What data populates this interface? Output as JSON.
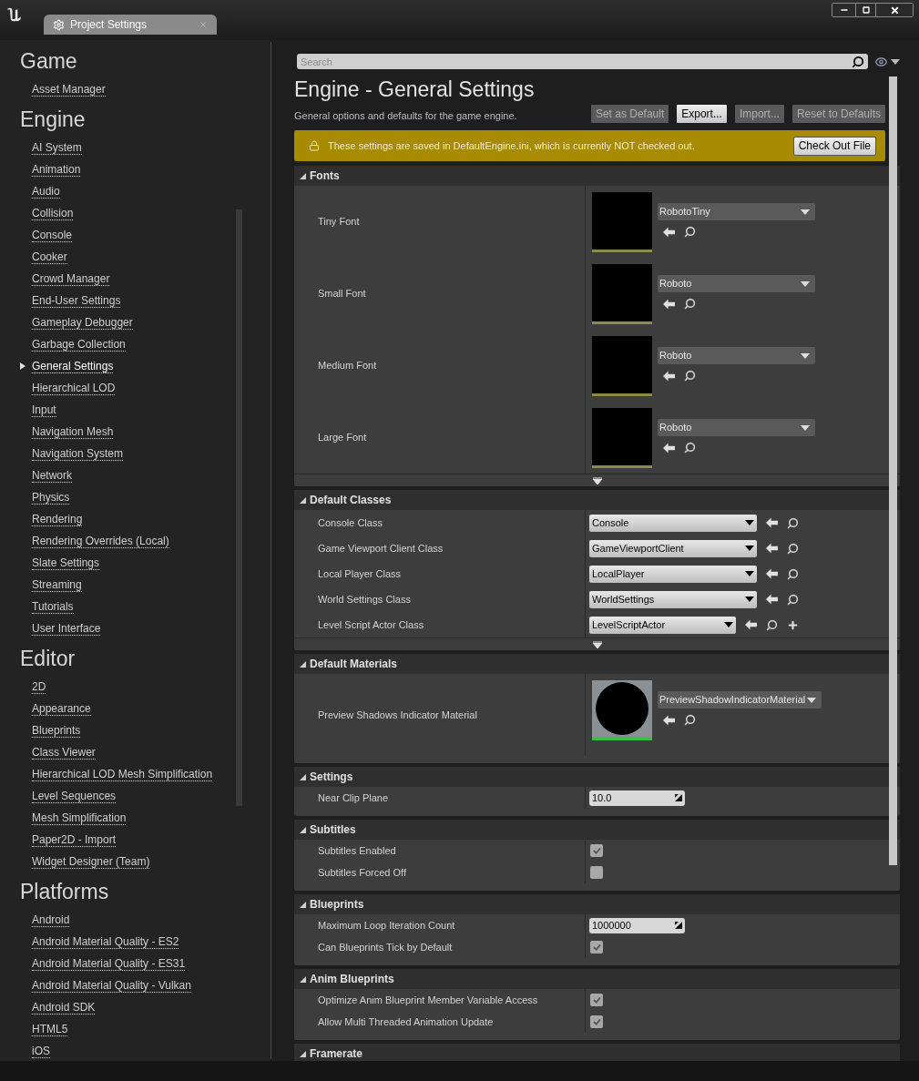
{
  "window": {
    "tab_title": "Project Settings"
  },
  "sidebar": {
    "groups": [
      {
        "title": "Game",
        "items": [
          {
            "label": "Asset Manager",
            "selected": false
          }
        ]
      },
      {
        "title": "Engine",
        "items": [
          {
            "label": "AI System",
            "selected": false
          },
          {
            "label": "Animation",
            "selected": false
          },
          {
            "label": "Audio",
            "selected": false
          },
          {
            "label": "Collision",
            "selected": false
          },
          {
            "label": "Console",
            "selected": false
          },
          {
            "label": "Cooker",
            "selected": false
          },
          {
            "label": "Crowd Manager",
            "selected": false
          },
          {
            "label": "End-User Settings",
            "selected": false
          },
          {
            "label": "Gameplay Debugger",
            "selected": false
          },
          {
            "label": "Garbage Collection",
            "selected": false
          },
          {
            "label": "General Settings",
            "selected": true
          },
          {
            "label": "Hierarchical LOD",
            "selected": false
          },
          {
            "label": "Input",
            "selected": false
          },
          {
            "label": "Navigation Mesh",
            "selected": false
          },
          {
            "label": "Navigation System",
            "selected": false
          },
          {
            "label": "Network",
            "selected": false
          },
          {
            "label": "Physics",
            "selected": false
          },
          {
            "label": "Rendering",
            "selected": false
          },
          {
            "label": "Rendering Overrides (Local)",
            "selected": false
          },
          {
            "label": "Slate Settings",
            "selected": false
          },
          {
            "label": "Streaming",
            "selected": false
          },
          {
            "label": "Tutorials",
            "selected": false
          },
          {
            "label": "User Interface",
            "selected": false
          }
        ]
      },
      {
        "title": "Editor",
        "items": [
          {
            "label": "2D",
            "selected": false
          },
          {
            "label": "Appearance",
            "selected": false
          },
          {
            "label": "Blueprints",
            "selected": false
          },
          {
            "label": "Class Viewer",
            "selected": false
          },
          {
            "label": "Hierarchical LOD Mesh Simplification",
            "selected": false
          },
          {
            "label": "Level Sequences",
            "selected": false
          },
          {
            "label": "Mesh Simplification",
            "selected": false
          },
          {
            "label": "Paper2D - Import",
            "selected": false
          },
          {
            "label": "Widget Designer (Team)",
            "selected": false
          }
        ]
      },
      {
        "title": "Platforms",
        "items": [
          {
            "label": "Android",
            "selected": false
          },
          {
            "label": "Android Material Quality - ES2",
            "selected": false
          },
          {
            "label": "Android Material Quality - ES31",
            "selected": false
          },
          {
            "label": "Android Material Quality - Vulkan",
            "selected": false
          },
          {
            "label": "Android SDK",
            "selected": false
          },
          {
            "label": "HTML5",
            "selected": false
          },
          {
            "label": "iOS",
            "selected": false
          }
        ]
      }
    ]
  },
  "search": {
    "placeholder": "Search"
  },
  "page": {
    "title": "Engine - General Settings",
    "subtitle": "General options and defaults for the game engine.",
    "buttons": [
      {
        "label": "Set as Default",
        "disabled": true
      },
      {
        "label": "Export...",
        "disabled": false
      },
      {
        "label": "Import...",
        "disabled": true
      },
      {
        "label": "Reset to Defaults",
        "disabled": true
      }
    ]
  },
  "banner": {
    "text": "These settings are saved in DefaultEngine.ini, which is currently NOT checked out.",
    "button": "Check Out File"
  },
  "sections": [
    {
      "title": "Fonts",
      "expanded": true,
      "show_advanced": true,
      "rows": [
        {
          "kind": "font",
          "label": "Tiny Font",
          "value": "RobotoTiny"
        },
        {
          "kind": "font",
          "label": "Small Font",
          "value": "Roboto"
        },
        {
          "kind": "font",
          "label": "Medium Font",
          "value": "Roboto"
        },
        {
          "kind": "font",
          "label": "Large Font",
          "value": "Roboto"
        }
      ]
    },
    {
      "title": "Default Classes",
      "expanded": true,
      "show_advanced": true,
      "rows": [
        {
          "kind": "class",
          "label": "Console Class",
          "value": "Console",
          "can_create": false
        },
        {
          "kind": "class",
          "label": "Game Viewport Client Class",
          "value": "GameViewportClient",
          "can_create": false
        },
        {
          "kind": "class",
          "label": "Local Player Class",
          "value": "LocalPlayer",
          "can_create": false
        },
        {
          "kind": "class",
          "label": "World Settings Class",
          "value": "WorldSettings",
          "can_create": false
        },
        {
          "kind": "class",
          "label": "Level Script Actor Class",
          "value": "LevelScriptActor",
          "can_create": true
        }
      ]
    },
    {
      "title": "Default Materials",
      "expanded": true,
      "show_advanced": false,
      "rows": [
        {
          "kind": "material",
          "label": "Preview Shadows Indicator Material",
          "value": "PreviewShadowIndicatorMaterial"
        }
      ]
    },
    {
      "title": "Settings",
      "expanded": true,
      "show_advanced": false,
      "rows": [
        {
          "kind": "number",
          "label": "Near Clip Plane",
          "value": "10.0"
        }
      ]
    },
    {
      "title": "Subtitles",
      "expanded": true,
      "show_advanced": false,
      "rows": [
        {
          "kind": "checkbox",
          "label": "Subtitles Enabled",
          "checked": true
        },
        {
          "kind": "checkbox",
          "label": "Subtitles Forced Off",
          "checked": false
        }
      ]
    },
    {
      "title": "Blueprints",
      "expanded": true,
      "show_advanced": false,
      "rows": [
        {
          "kind": "number",
          "label": "Maximum Loop Iteration Count",
          "value": "1000000"
        },
        {
          "kind": "checkbox",
          "label": "Can Blueprints Tick by Default",
          "checked": true
        }
      ]
    },
    {
      "title": "Anim Blueprints",
      "expanded": true,
      "show_advanced": false,
      "rows": [
        {
          "kind": "checkbox",
          "label": "Optimize Anim Blueprint Member Variable Access",
          "checked": true
        },
        {
          "kind": "checkbox",
          "label": "Allow Multi Threaded Animation Update",
          "checked": true
        }
      ]
    },
    {
      "title": "Framerate",
      "expanded": true,
      "show_advanced": false
    }
  ]
}
